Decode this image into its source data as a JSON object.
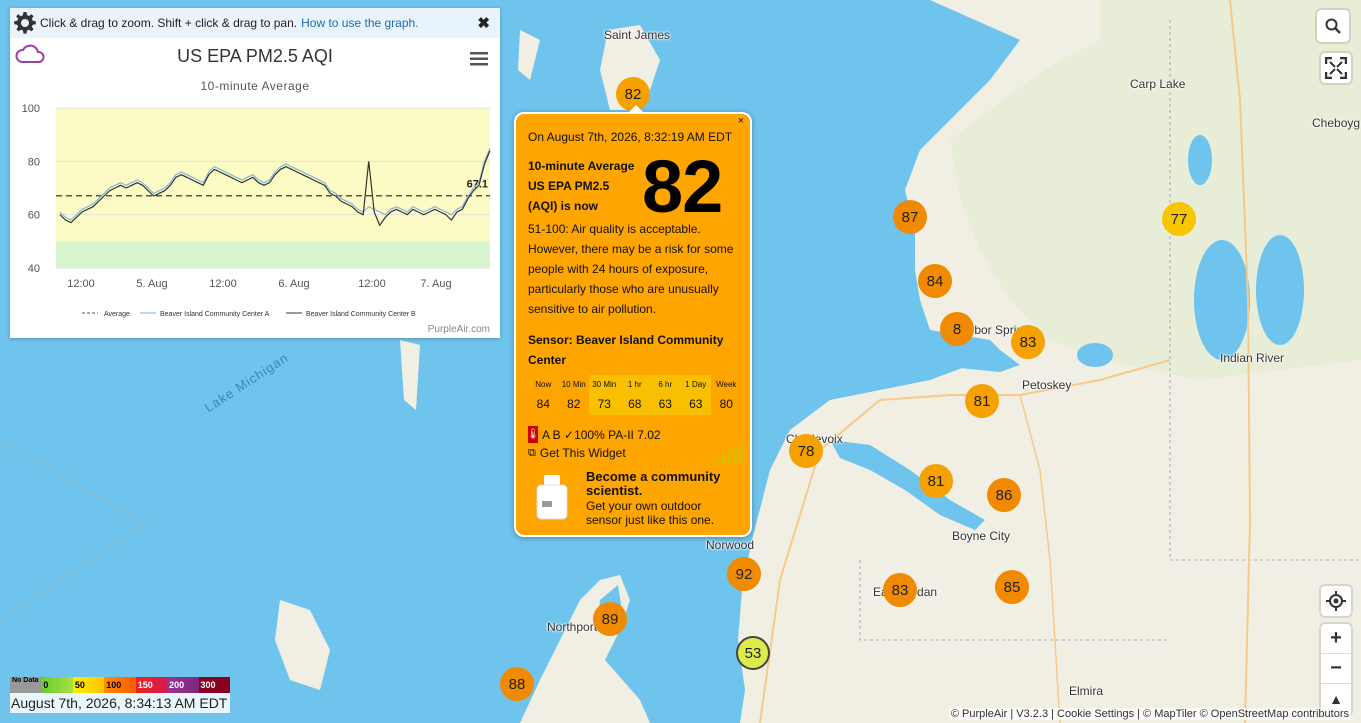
{
  "chart": {
    "help_text": "Click & drag to zoom. Shift + click & drag to pan.",
    "help_link": "How to use the graph.",
    "close": "✖",
    "title": "US EPA PM2.5 AQI",
    "subtitle": "10-minute Average",
    "y_ticks": [
      "100",
      "80",
      "60",
      "40"
    ],
    "x_ticks": [
      "12:00",
      "5. Aug",
      "12:00",
      "6. Aug",
      "12:00",
      "7. Aug"
    ],
    "current_label": "67.1",
    "legend": {
      "average": "Average",
      "series_a": "Beaver Island Community Center A",
      "series_b": "Beaver Island Community Center B"
    },
    "credit": "PurpleAir.com"
  },
  "chart_data": {
    "type": "line",
    "title": "US EPA PM2.5 AQI",
    "subtitle": "10-minute Average",
    "ylim": [
      40,
      100
    ],
    "x_ticks": [
      "12:00",
      "5. Aug",
      "12:00",
      "6. Aug",
      "12:00",
      "7. Aug"
    ],
    "average": 67.1,
    "series": [
      {
        "name": "Beaver Island Community Center A",
        "color": "#7fb6e0",
        "values": [
          61,
          59,
          58,
          60,
          62,
          63,
          64,
          66,
          68,
          70,
          71,
          72,
          71,
          72,
          73,
          72,
          70,
          68,
          69,
          70,
          72,
          75,
          76,
          75,
          74,
          73,
          72,
          76,
          78,
          77,
          76,
          75,
          74,
          73,
          74,
          75,
          73,
          72,
          73,
          76,
          78,
          79,
          78,
          77,
          76,
          75,
          74,
          73,
          72,
          69,
          68,
          66,
          65,
          64,
          62,
          61,
          63,
          62,
          61,
          60,
          62,
          63,
          62,
          61,
          63,
          62,
          61,
          62,
          63,
          62,
          61,
          60,
          62,
          63,
          67,
          70,
          72,
          80,
          85
        ]
      },
      {
        "name": "Beaver Island Community Center B",
        "color": "#333333",
        "values": [
          60,
          58,
          57,
          59,
          61,
          62,
          63,
          65,
          67,
          69,
          70,
          71,
          70,
          71,
          72,
          71,
          69,
          67,
          68,
          69,
          71,
          74,
          75,
          74,
          73,
          72,
          71,
          75,
          77,
          76,
          75,
          74,
          73,
          72,
          73,
          74,
          72,
          71,
          72,
          75,
          77,
          78,
          77,
          76,
          75,
          74,
          73,
          72,
          71,
          68,
          67,
          65,
          64,
          63,
          61,
          60,
          80,
          61,
          56,
          59,
          61,
          62,
          61,
          60,
          62,
          61,
          60,
          61,
          62,
          61,
          60,
          58,
          61,
          62,
          66,
          69,
          71,
          79,
          84
        ]
      }
    ],
    "bands": [
      {
        "from": 50,
        "to": 100,
        "color": "#fdfbc4"
      },
      {
        "from": 40,
        "to": 50,
        "color": "#d9f5cf"
      }
    ]
  },
  "popup": {
    "close": "×",
    "date": "On August 7th, 2026, 8:32:19 AM EDT",
    "label_line1": "10-minute Average",
    "label_line2": "US EPA PM2.5",
    "label_line3": "(AQI) is now",
    "aqi": "82",
    "description": "51-100: Air quality is acceptable. However, there may be a risk for some people with 24 hours of exposure, particularly those who are unusually sensitive to air pollution.",
    "sensor": "Sensor: Beaver Island Community Center",
    "periods": [
      {
        "label": "Now",
        "value": "84",
        "color": "#ffa500"
      },
      {
        "label": "10 Min",
        "value": "82",
        "color": "#ffa500"
      },
      {
        "label": "30 Min",
        "value": "73",
        "color": "#f8c000"
      },
      {
        "label": "1 hr",
        "value": "68",
        "color": "#f8c000"
      },
      {
        "label": "6 hr",
        "value": "63",
        "color": "#f8c000"
      },
      {
        "label": "1 Day",
        "value": "63",
        "color": "#f8c000"
      },
      {
        "label": "Week",
        "value": "80",
        "color": "#ffa500"
      }
    ],
    "status": "A B ✓100% PA-II 7.02",
    "widget": "Get This Widget",
    "promo_title": "Become a community scientist.",
    "promo_text": "Get your own outdoor sensor just like this one."
  },
  "map": {
    "places": [
      "Saint James",
      "Carp Lake",
      "Cheboyg",
      "Harbor Springs",
      "Petoskey",
      "Indian River",
      "Charlevoix",
      "Boyne City",
      "Norwood",
      "East Jordan",
      "Northport",
      "Elmira"
    ],
    "lake_label": "Lake Michigan",
    "markers": [
      "82",
      "87",
      "77",
      "84",
      "8",
      "83",
      "81",
      "78",
      "81",
      "86",
      "92",
      "89",
      "85",
      "53",
      "88",
      "83"
    ]
  },
  "legend": {
    "items": [
      {
        "label": "No Data",
        "color": "#999999"
      },
      {
        "label": "0",
        "color": "#66cc33"
      },
      {
        "label": "50",
        "color": "#ffee00"
      },
      {
        "label": "100",
        "color": "#ff8c00"
      },
      {
        "label": "150",
        "color": "#ee2222"
      },
      {
        "label": "200",
        "color": "#993399"
      },
      {
        "label": "300",
        "color": "#880022"
      }
    ],
    "date": "August 7th, 2026, 8:34:13 AM EDT"
  },
  "attribution": "© PurpleAir | V3.2.3 | Cookie Settings | © MapTiler © OpenStreetMap contributors"
}
